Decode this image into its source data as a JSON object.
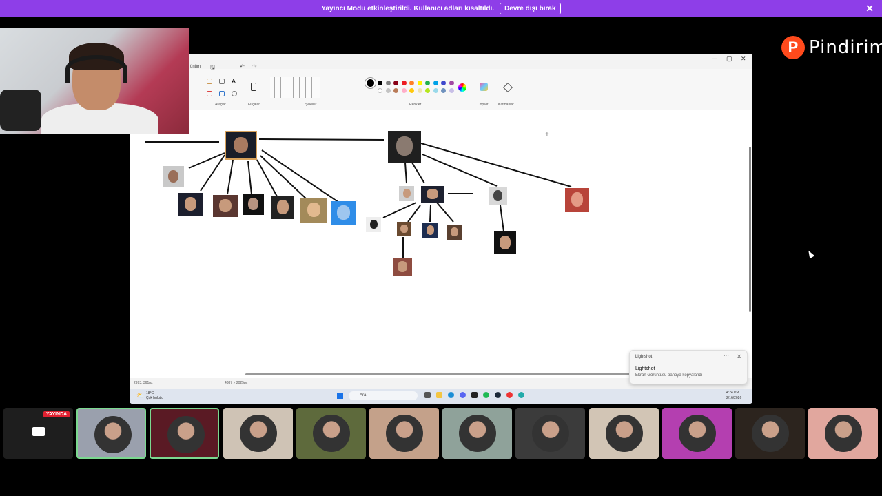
{
  "banner": {
    "message": "Yayıncı Modu etkinleştirildi. Kullanıcı adları kısaltıldı.",
    "button": "Devre dışı bırak",
    "close": "✕"
  },
  "logo": {
    "letter": "P",
    "text": "Pindirim"
  },
  "paint": {
    "tab_label": "ünüm",
    "ribbon_groups": {
      "tools": "Araçlar",
      "brushes": "Fırçalar",
      "shapes": "Şekiller",
      "colors": "Renkler",
      "copilot": "Copilot",
      "layers": "Katmanlar"
    },
    "colors": [
      "#000000",
      "#7f7f7f",
      "#880015",
      "#ed1c24",
      "#ff7f27",
      "#fff200",
      "#22b14c",
      "#00a2e8",
      "#3f48cc",
      "#a349a4",
      "#ffffff",
      "#c3c3c3",
      "#b97a57",
      "#ffaec9",
      "#ffc90e",
      "#efe4b0",
      "#b5e61d",
      "#99d9ea",
      "#7092be",
      "#c8bfe7"
    ],
    "status": {
      "cursor": "2993, 361px",
      "size": "4887 × 2025px"
    }
  },
  "taskbar": {
    "weather_temp": "18°C",
    "weather_desc": "Çok bulutlu",
    "search": "Ara",
    "time": "4:24 PM",
    "date": "2/16/2026"
  },
  "toast": {
    "app": "Lightshot",
    "title": "Lightshot",
    "message": "Ekran Görüntüsü panoya kopyalandı",
    "close": "✕",
    "more": "···"
  },
  "participants": {
    "live_label": "YAYINDA",
    "tiles": [
      {
        "bg": "#1e1e1e"
      },
      {
        "bg": "#9aa0ad"
      },
      {
        "bg": "#5a1a24"
      },
      {
        "bg": "#cfc3b5"
      },
      {
        "bg": "#5e6a3c"
      },
      {
        "bg": "#c4a18a"
      },
      {
        "bg": "#8fa29a"
      },
      {
        "bg": "#3b3b3b"
      },
      {
        "bg": "#d2c5b5"
      },
      {
        "bg": "#b43fb0"
      },
      {
        "bg": "#2c241e"
      },
      {
        "bg": "#e1a79e"
      }
    ]
  }
}
